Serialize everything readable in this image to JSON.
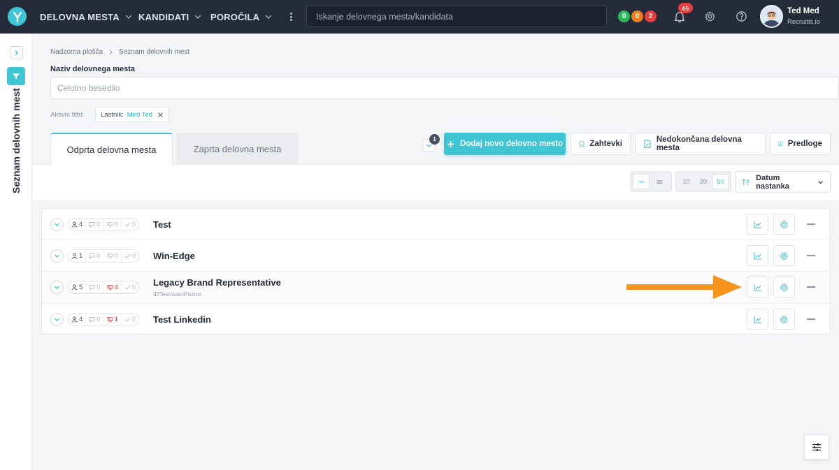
{
  "nav": {
    "items": [
      {
        "label": "DELOVNA MESTA"
      },
      {
        "label": "KANDIDATI"
      },
      {
        "label": "POROČILA"
      }
    ],
    "search_placeholder": "Iskanje delovnega mesta/kandidata",
    "status_dots": [
      {
        "value": "0",
        "color": "#2eb85c"
      },
      {
        "value": "0",
        "color": "#f07c19"
      },
      {
        "value": "2",
        "color": "#e53e3e"
      }
    ],
    "notifications_count": "65",
    "user": {
      "name": "Ted Med",
      "org": "Recruitis.io"
    }
  },
  "sidebar": {
    "title": "Seznam delovnih mest"
  },
  "breadcrumb": {
    "items": [
      "Nadzorna plošča",
      "Seznam delovnih mest"
    ]
  },
  "filter": {
    "label": "Naziv delovnega mesta",
    "placeholder": "Celotno besedilo",
    "active_label": "Aktivni filtri:",
    "chip_key": "Lastnik:",
    "chip_value": "Med Ted"
  },
  "tabs": [
    {
      "label": "Odprta delovna mesta",
      "active": true
    },
    {
      "label": "Zaprta delovna mesta",
      "active": false
    }
  ],
  "actions": {
    "badge": "1",
    "add": "Dodaj novo delovno mesto",
    "requests": "Zahtevki",
    "unfinished": "Nedokončana delovna mesta",
    "templates": "Predloge"
  },
  "toolbar": {
    "page_sizes": [
      "10",
      "20",
      "50"
    ],
    "page_size_selected": "50",
    "sort_label": "Datum nastanka"
  },
  "jobs": [
    {
      "title": "Test",
      "subtitle": "",
      "candidates": "4",
      "comments": "0",
      "rejected": "0",
      "accepted": "0"
    },
    {
      "title": "Win-Edge",
      "subtitle": "",
      "candidates": "1",
      "comments": "0",
      "rejected": "0",
      "accepted": "0"
    },
    {
      "title": "Legacy Brand Representative",
      "subtitle": "IDTestovaciPozice",
      "candidates": "5",
      "comments": "0",
      "rejected": "4",
      "accepted": "0"
    },
    {
      "title": "Test Linkedin",
      "subtitle": "",
      "candidates": "4",
      "comments": "0",
      "rejected": "1",
      "accepted": "0"
    }
  ],
  "colors": {
    "accent": "#3ec6d5",
    "topbar": "#262b3a",
    "arrow": "#f7941d",
    "danger": "#d93636"
  }
}
